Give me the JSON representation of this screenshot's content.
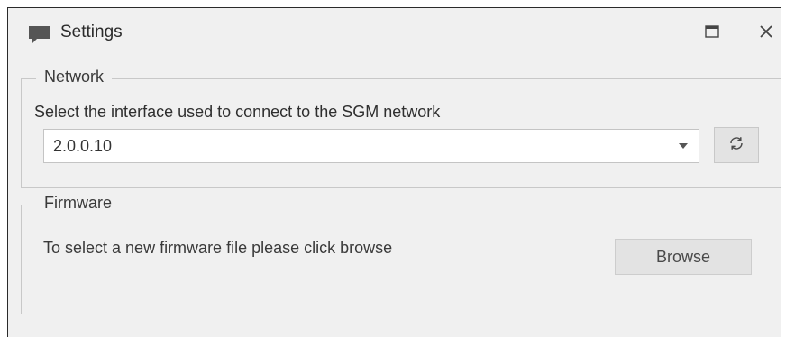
{
  "window": {
    "title": "Settings",
    "icon": "speech-bubble-icon",
    "controls": {
      "maximize_icon": "maximize-icon",
      "close_icon": "close-icon"
    }
  },
  "network": {
    "legend": "Network",
    "description": "Select the interface used to connect to the SGM network",
    "interface_select": {
      "selected_value": "2.0.0.10"
    },
    "refresh_icon": "refresh-icon"
  },
  "firmware": {
    "legend": "Firmware",
    "description": "To select a new firmware file please click browse",
    "browse_label": "Browse"
  },
  "colors": {
    "window_background": "#f0f0f0",
    "group_border": "#c8c8c8",
    "button_background": "#e3e3e3"
  }
}
